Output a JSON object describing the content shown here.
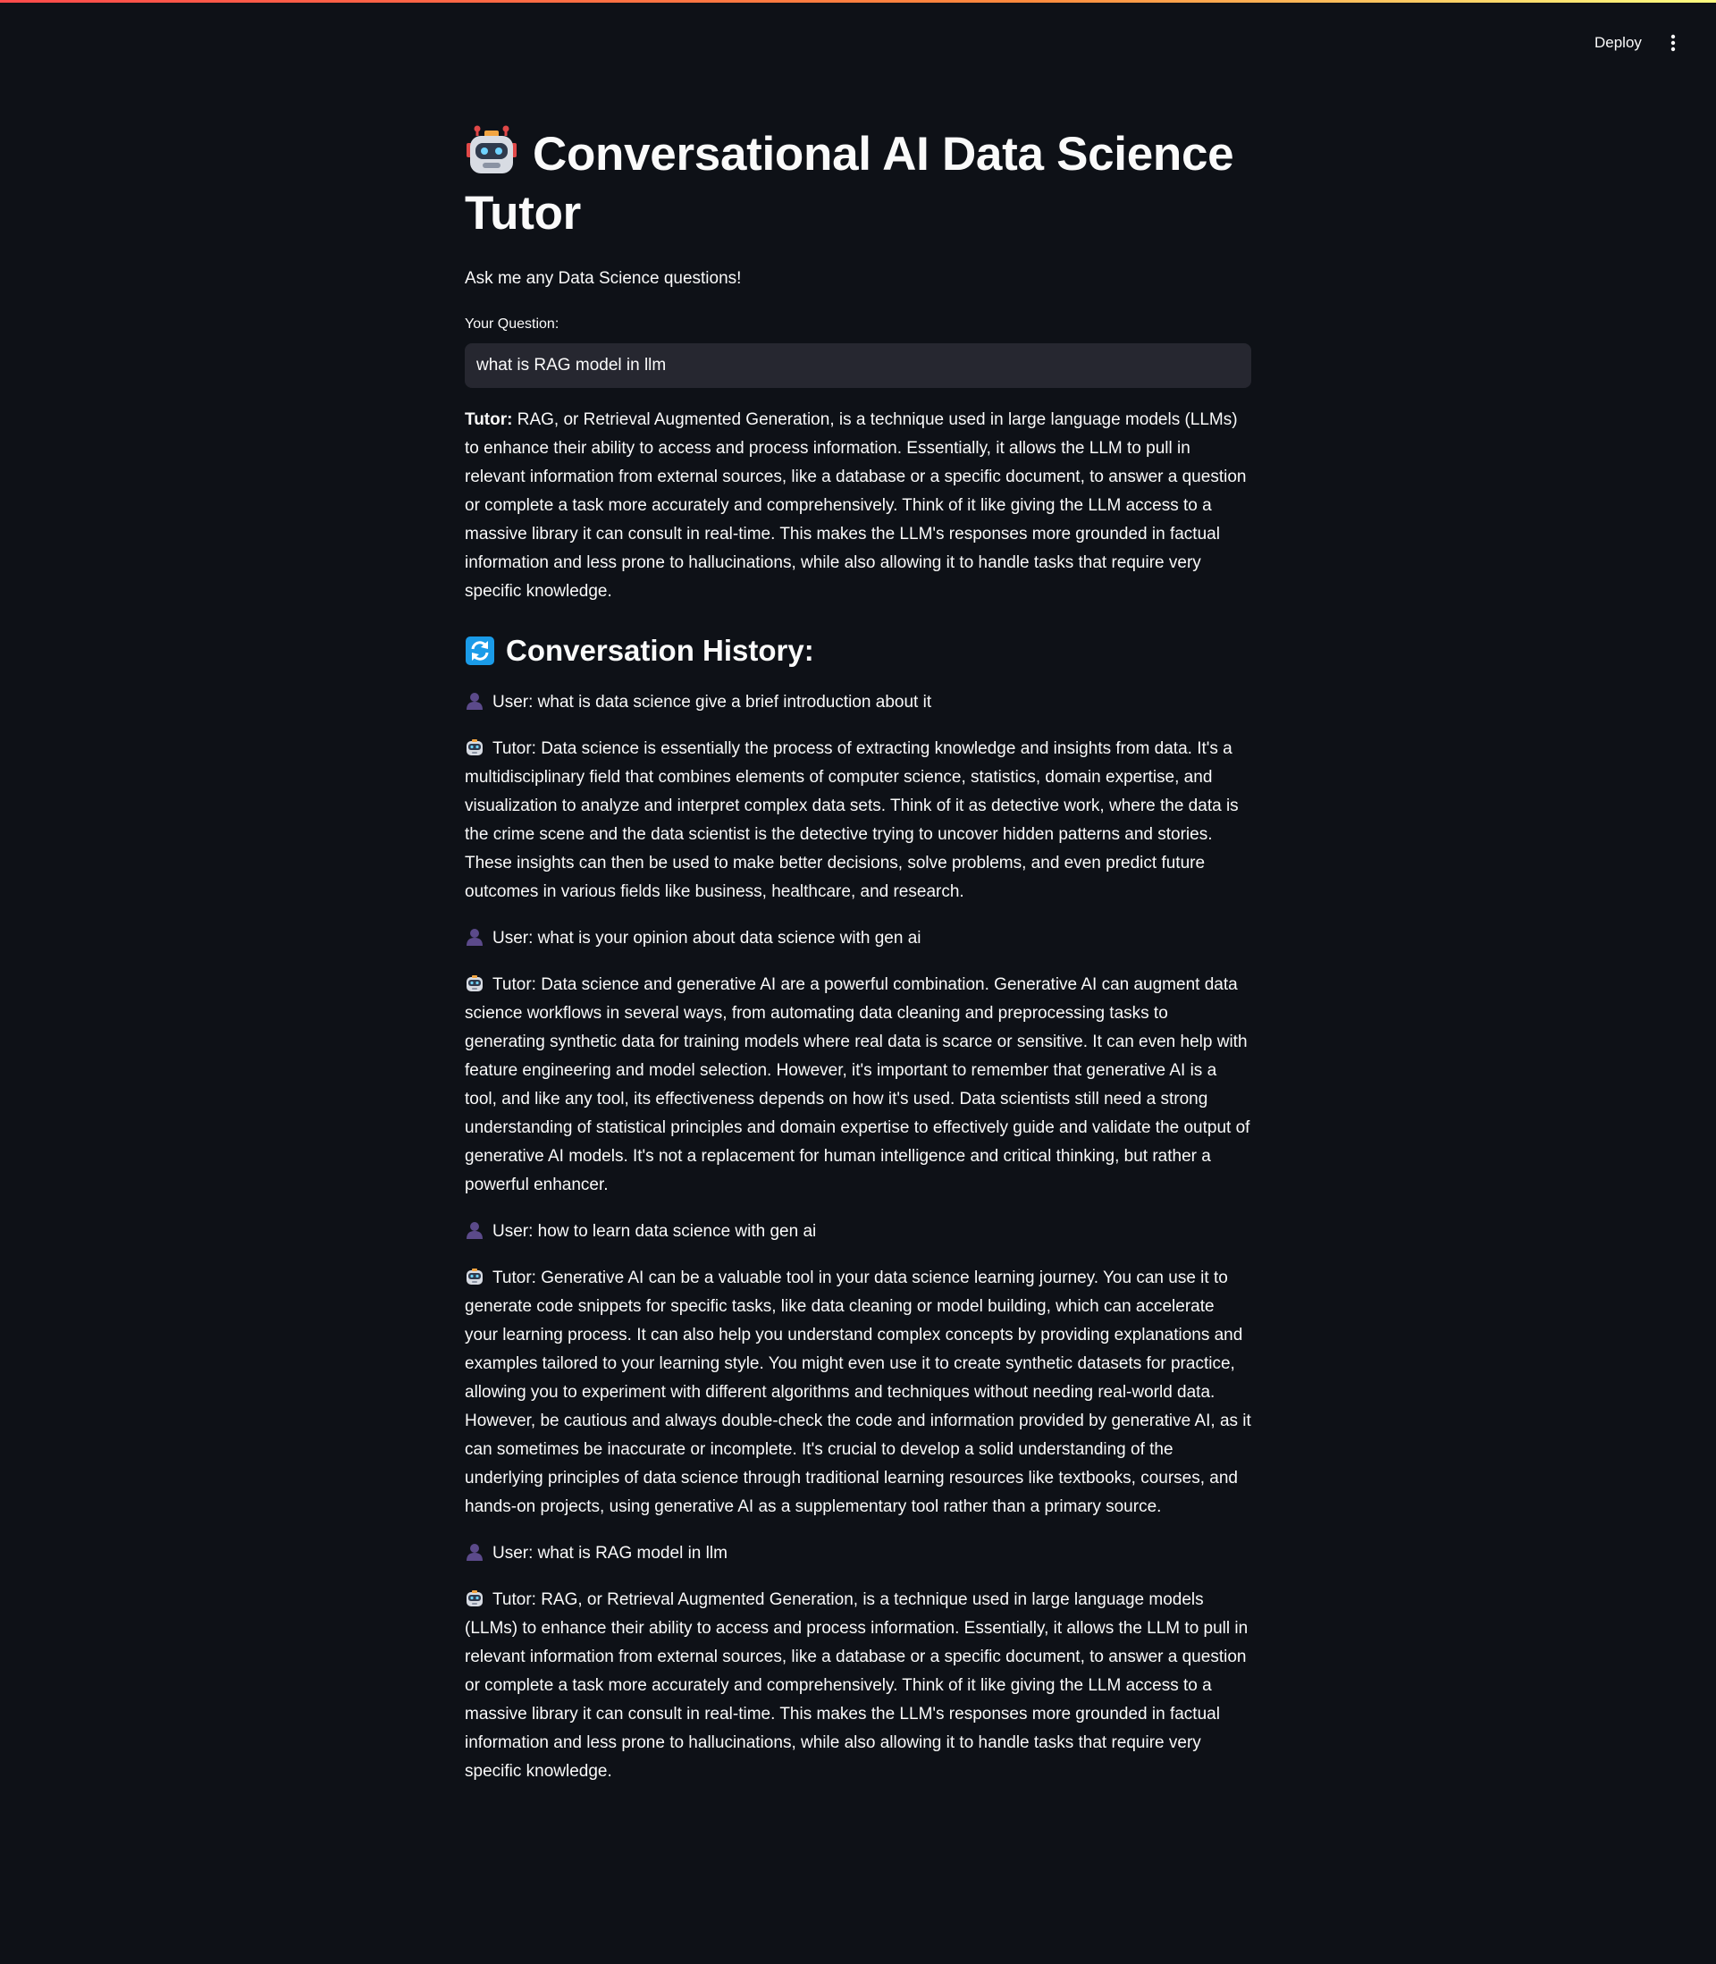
{
  "header": {
    "deploy_label": "Deploy"
  },
  "app": {
    "title": "Conversational AI Data Science Tutor",
    "subtitle": "Ask me any Data Science questions!",
    "question_label": "Your Question:",
    "question_value": "what is RAG model in llm"
  },
  "answer": {
    "speaker": "Tutor:",
    "text": " RAG, or Retrieval Augmented Generation, is a technique used in large language models (LLMs) to enhance their ability to access and process information. Essentially, it allows the LLM to pull in relevant information from external sources, like a database or a specific document, to answer a question or complete a task more accurately and comprehensively. Think of it like giving the LLM access to a massive library it can consult in real-time. This makes the LLM's responses more grounded in factual information and less prone to hallucinations, while also allowing it to handle tasks that require very specific knowledge."
  },
  "history": {
    "heading": "Conversation History:",
    "messages": [
      {
        "role": "user",
        "text": "User: what is data science give a brief introduction about it"
      },
      {
        "role": "tutor",
        "text": "Tutor: Data science is essentially the process of extracting knowledge and insights from data. It's a multidisciplinary field that combines elements of computer science, statistics, domain expertise, and visualization to analyze and interpret complex data sets. Think of it as detective work, where the data is the crime scene and the data scientist is the detective trying to uncover hidden patterns and stories. These insights can then be used to make better decisions, solve problems, and even predict future outcomes in various fields like business, healthcare, and research."
      },
      {
        "role": "user",
        "text": "User: what is your opinion about data science with gen ai"
      },
      {
        "role": "tutor",
        "text": "Tutor: Data science and generative AI are a powerful combination. Generative AI can augment data science workflows in several ways, from automating data cleaning and preprocessing tasks to generating synthetic data for training models where real data is scarce or sensitive. It can even help with feature engineering and model selection. However, it's important to remember that generative AI is a tool, and like any tool, its effectiveness depends on how it's used. Data scientists still need a strong understanding of statistical principles and domain expertise to effectively guide and validate the output of generative AI models. It's not a replacement for human intelligence and critical thinking, but rather a powerful enhancer."
      },
      {
        "role": "user",
        "text": "User: how to learn data science with gen ai"
      },
      {
        "role": "tutor",
        "text": "Tutor: Generative AI can be a valuable tool in your data science learning journey. You can use it to generate code snippets for specific tasks, like data cleaning or model building, which can accelerate your learning process. It can also help you understand complex concepts by providing explanations and examples tailored to your learning style. You might even use it to create synthetic datasets for practice, allowing you to experiment with different algorithms and techniques without needing real-world data. However, be cautious and always double-check the code and information provided by generative AI, as it can sometimes be inaccurate or incomplete. It's crucial to develop a solid understanding of the underlying principles of data science through traditional learning resources like textbooks, courses, and hands-on projects, using generative AI as a supplementary tool rather than a primary source."
      },
      {
        "role": "user",
        "text": "User: what is RAG model in llm"
      },
      {
        "role": "tutor",
        "text": "Tutor: RAG, or Retrieval Augmented Generation, is a technique used in large language models (LLMs) to enhance their ability to access and process information. Essentially, it allows the LLM to pull in relevant information from external sources, like a database or a specific document, to answer a question or complete a task more accurately and comprehensively. Think of it like giving the LLM access to a massive library it can consult in real-time. This makes the LLM's responses more grounded in factual information and less prone to hallucinations, while also allowing it to handle tasks that require very specific knowledge."
      }
    ]
  },
  "icons": {
    "title": "robot-icon",
    "history": "arrows-counterclockwise-icon",
    "user": "bust-silhouette-icon",
    "tutor": "robot-icon",
    "menu": "vertical-ellipsis-icon"
  },
  "colors": {
    "background": "#0e1117",
    "text": "#fafafa",
    "input_background": "#262730",
    "accent_gradient_start": "#ff4b4b",
    "accent_gradient_end": "#fffd80",
    "history_icon_blue": "#1a9be8"
  }
}
